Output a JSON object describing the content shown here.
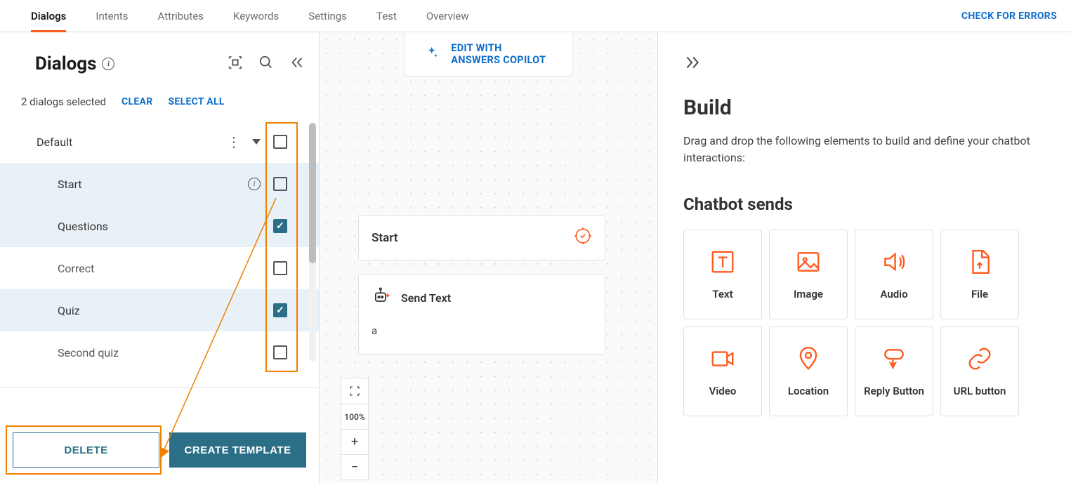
{
  "tabs": [
    "Dialogs",
    "Intents",
    "Attributes",
    "Keywords",
    "Settings",
    "Test",
    "Overview"
  ],
  "active_tab": "Dialogs",
  "check_errors_label": "CHECK FOR ERRORS",
  "left": {
    "title": "Dialogs",
    "selected_text": "2 dialogs selected",
    "clear_label": "CLEAR",
    "select_all_label": "SELECT ALL",
    "group_name": "Default",
    "dialogs": [
      {
        "name": "Start",
        "checked": false,
        "info": true
      },
      {
        "name": "Questions",
        "checked": true
      },
      {
        "name": "Correct",
        "checked": false
      },
      {
        "name": "Quiz",
        "checked": true
      },
      {
        "name": "Second quiz",
        "checked": false
      }
    ],
    "delete_label": "DELETE",
    "create_template_label": "CREATE TEMPLATE"
  },
  "copilot_label": "EDIT WITH ANSWERS COPILOT",
  "canvas": {
    "start_card": "Start",
    "sendtext_title": "Send Text",
    "sendtext_body": "a",
    "zoom": "100%"
  },
  "build": {
    "title": "Build",
    "desc": "Drag and drop the following elements to build and define your chatbot interactions:",
    "section": "Chatbot sends",
    "elements": [
      "Text",
      "Image",
      "Audio",
      "File",
      "Video",
      "Location",
      "Reply Button",
      "URL button"
    ]
  }
}
